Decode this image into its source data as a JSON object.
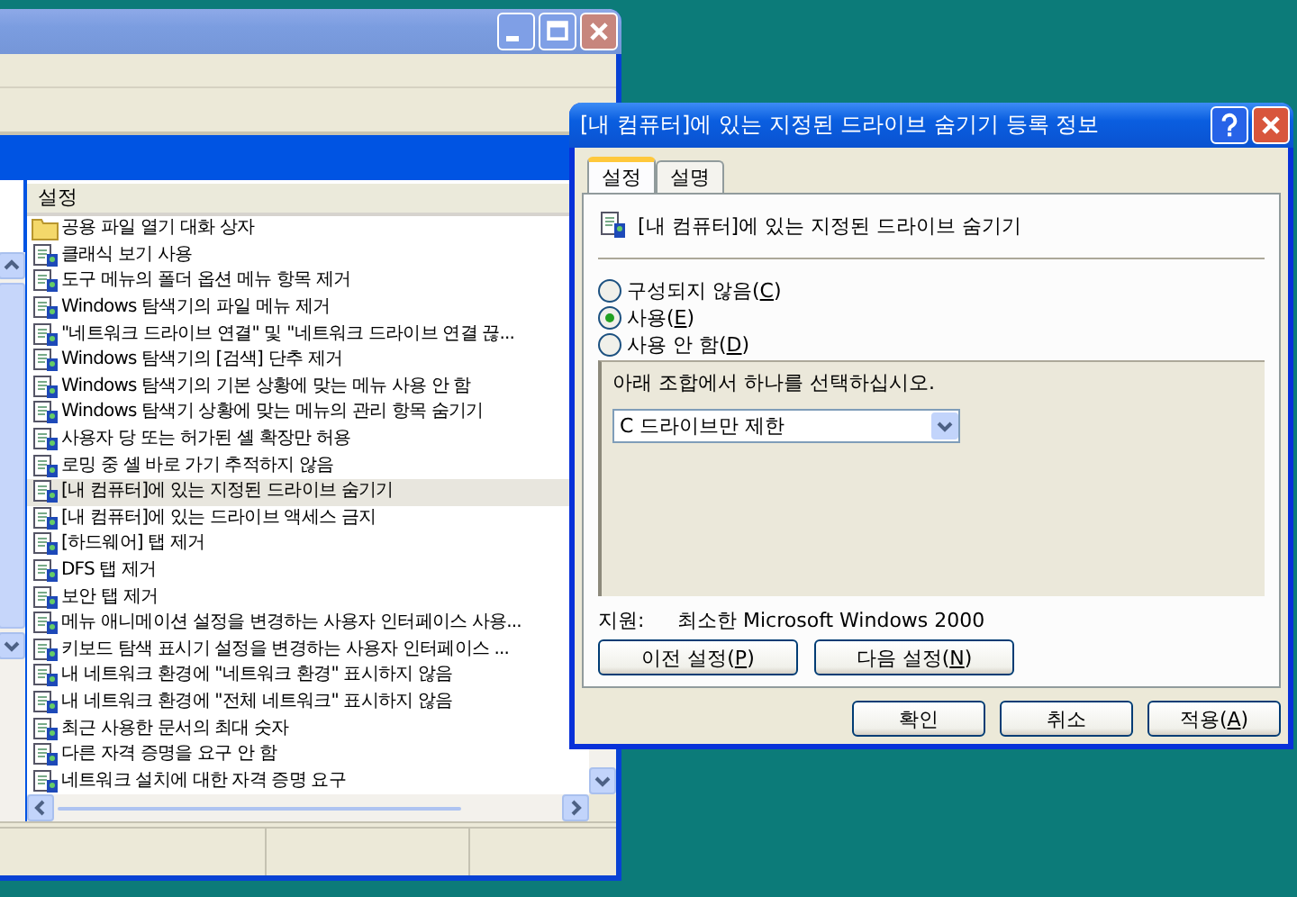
{
  "main_window": {
    "list_header": "설정",
    "items": [
      {
        "kind": "folder",
        "label": "공용 파일 열기 대화 상자",
        "selected": false
      },
      {
        "kind": "setting",
        "label": "클래식 보기 사용",
        "selected": false
      },
      {
        "kind": "setting",
        "label": "도구 메뉴의 폴더 옵션 메뉴 항목 제거",
        "selected": false
      },
      {
        "kind": "setting",
        "label": "Windows 탐색기의 파일 메뉴 제거",
        "selected": false
      },
      {
        "kind": "setting",
        "label": "\"네트워크 드라이브 연결\" 및 \"네트워크 드라이브 연결 끊...",
        "selected": false
      },
      {
        "kind": "setting",
        "label": "Windows 탐색기의 [검색] 단추 제거",
        "selected": false
      },
      {
        "kind": "setting",
        "label": "Windows 탐색기의 기본 상황에 맞는 메뉴 사용 안 함",
        "selected": false
      },
      {
        "kind": "setting",
        "label": "Windows 탐색기 상황에 맞는 메뉴의 관리 항목 숨기기",
        "selected": false
      },
      {
        "kind": "setting",
        "label": "사용자 당 또는 허가된 셸 확장만 허용",
        "selected": false
      },
      {
        "kind": "setting",
        "label": "로밍 중 셸 바로 가기 추적하지 않음",
        "selected": false
      },
      {
        "kind": "setting",
        "label": "[내 컴퓨터]에 있는 지정된 드라이브 숨기기",
        "selected": true
      },
      {
        "kind": "setting",
        "label": "[내 컴퓨터]에 있는 드라이브 액세스 금지",
        "selected": false
      },
      {
        "kind": "setting",
        "label": "[하드웨어] 탭 제거",
        "selected": false
      },
      {
        "kind": "setting",
        "label": "DFS 탭 제거",
        "selected": false
      },
      {
        "kind": "setting",
        "label": "보안 탭 제거",
        "selected": false
      },
      {
        "kind": "setting",
        "label": "메뉴 애니메이션 설정을 변경하는 사용자 인터페이스 사용...",
        "selected": false
      },
      {
        "kind": "setting",
        "label": "키보드 탐색 표시기 설정을 변경하는 사용자 인터페이스 ...",
        "selected": false
      },
      {
        "kind": "setting",
        "label": "내 네트워크 환경에 \"네트워크 환경\" 표시하지 않음",
        "selected": false
      },
      {
        "kind": "setting",
        "label": "내 네트워크 환경에 \"전체 네트워크\" 표시하지 않음",
        "selected": false
      },
      {
        "kind": "setting",
        "label": "최근 사용한 문서의 최대 숫자",
        "selected": false
      },
      {
        "kind": "setting",
        "label": "다른 자격 증명을 요구 안 함",
        "selected": false
      },
      {
        "kind": "setting",
        "label": "네트워크 설치에 대한 자격 증명 요구",
        "selected": false
      }
    ]
  },
  "dialog": {
    "title": "[내 컴퓨터]에 있는 지정된 드라이브 숨기기 등록 정보",
    "tabs": [
      {
        "label": "설정",
        "selected": true
      },
      {
        "label": "설명",
        "selected": false
      }
    ],
    "setting_name": "[내 컴퓨터]에 있는 지정된 드라이브 숨기기",
    "options": [
      {
        "label": "구성되지 않음(C)",
        "selected": false
      },
      {
        "label": "사용(E)",
        "selected": true
      },
      {
        "label": "사용 안 함(D)",
        "selected": false
      }
    ],
    "combo_prompt": "아래 조합에서 하나를 선택하십시오.",
    "combo_value": "C 드라이브만 제한",
    "supported_label": "지원:",
    "supported_value": "최소한 Microsoft Windows 2000",
    "nav_buttons": [
      "이전 설정(P)",
      "다음 설정(N)"
    ],
    "buttons": [
      "확인",
      "취소",
      "적용(A)"
    ]
  }
}
